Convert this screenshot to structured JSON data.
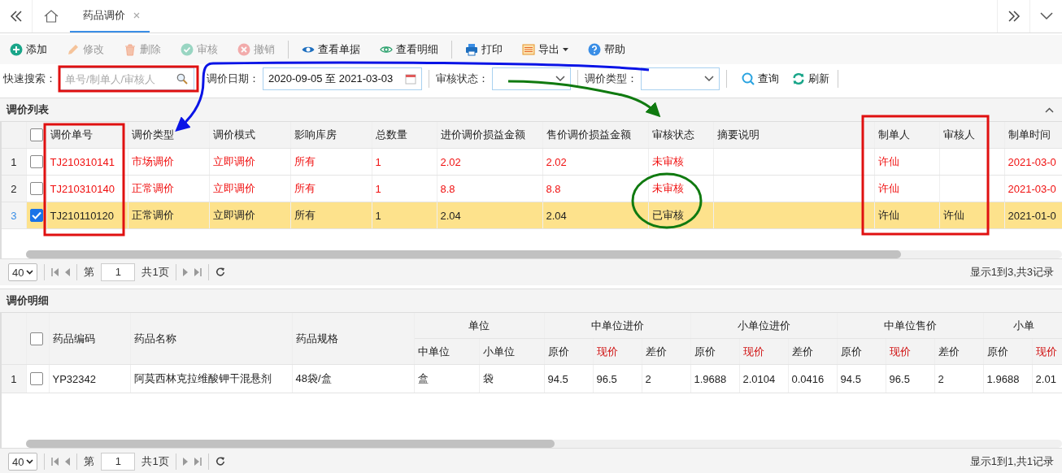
{
  "tab_bar": {
    "tabs": [
      {
        "label": "药品调价",
        "selected": true,
        "closable": true
      }
    ]
  },
  "toolbar_groups": [
    {
      "buttons": [
        {
          "kind": "add",
          "label": "添加",
          "disabled": false
        },
        {
          "kind": "edit",
          "label": "修改",
          "disabled": true
        },
        {
          "kind": "delete",
          "label": "删除",
          "disabled": true
        },
        {
          "kind": "audit",
          "label": "审核",
          "disabled": true
        },
        {
          "kind": "revoke",
          "label": "撤销",
          "disabled": true
        }
      ]
    },
    {
      "buttons": [
        {
          "kind": "view",
          "label": "查看单据",
          "disabled": false
        },
        {
          "kind": "detail",
          "label": "查看明细",
          "disabled": false
        }
      ]
    },
    {
      "buttons": [
        {
          "kind": "print",
          "label": "打印",
          "disabled": false
        },
        {
          "kind": "export",
          "label": "导出",
          "disabled": false,
          "dropdown": true
        },
        {
          "kind": "help",
          "label": "帮助",
          "disabled": false
        }
      ]
    }
  ],
  "filters": {
    "quick_search": {
      "label": "快速搜索：",
      "placeholder": "单号/制单人/审核人"
    },
    "date": {
      "label": "调价日期：",
      "value": "2020-09-05 至 2021-03-03"
    },
    "status": {
      "label": "审核状态："
    },
    "type": {
      "label": "调价类型："
    },
    "actions": [
      {
        "kind": "search",
        "label": "查询"
      },
      {
        "kind": "refresh",
        "label": "刷新"
      }
    ]
  },
  "list_panel": {
    "title": "调价列表",
    "all_checked": false,
    "columns": [
      "调价单号",
      "调价类型",
      "调价模式",
      "影响库房",
      "总数量",
      "进价调价损益金额",
      "售价调价损益金额",
      "审核状态",
      "摘要说明",
      "制单人",
      "审核人",
      "制单时间"
    ],
    "rows": [
      {
        "row_number": "1",
        "selected": false,
        "pending": true,
        "cells": [
          "TJ210310141",
          "市场调价",
          "立即调价",
          "所有",
          "1",
          "2.02",
          "2.02",
          "未审核",
          null,
          "许仙",
          null,
          "2021-03-0"
        ]
      },
      {
        "row_number": "2",
        "selected": false,
        "pending": true,
        "cells": [
          "TJ210310140",
          "正常调价",
          "立即调价",
          "所有",
          "1",
          "8.8",
          "8.8",
          "未审核",
          null,
          "许仙",
          null,
          "2021-03-0"
        ]
      },
      {
        "row_number": "3",
        "selected": true,
        "pending": false,
        "cells": [
          "TJ210110120",
          "正常调价",
          "立即调价",
          "所有",
          "1",
          "2.04",
          "2.04",
          "已审核",
          null,
          "许仙",
          "许仙",
          "2021-01-0"
        ]
      }
    ],
    "pager": {
      "page_size": "40",
      "page_label": "第",
      "page": "1",
      "total_pages": "共1页",
      "summary": "显示1到3,共3记录"
    }
  },
  "detail_panel": {
    "title": "调价明细",
    "all_checked": false,
    "fixed_columns": [
      "药品编码",
      "药品名称",
      "药品规格"
    ],
    "groups": [
      {
        "label": "单位",
        "columns": [
          {
            "label": "中单位",
            "emphasis": false
          },
          {
            "label": "小单位",
            "emphasis": false
          }
        ]
      },
      {
        "label": "中单位进价",
        "columns": [
          {
            "label": "原价",
            "emphasis": false
          },
          {
            "label": "现价",
            "emphasis": true
          },
          {
            "label": "差价",
            "emphasis": false
          }
        ]
      },
      {
        "label": "小单位进价",
        "columns": [
          {
            "label": "原价",
            "emphasis": false
          },
          {
            "label": "现价",
            "emphasis": true
          },
          {
            "label": "差价",
            "emphasis": false
          }
        ]
      },
      {
        "label": "中单位售价",
        "columns": [
          {
            "label": "原价",
            "emphasis": false
          },
          {
            "label": "现价",
            "emphasis": true
          },
          {
            "label": "差价",
            "emphasis": false
          }
        ]
      },
      {
        "label": "小单",
        "columns": [
          {
            "label": "原价",
            "emphasis": false
          },
          {
            "label": "现价",
            "emphasis": true
          }
        ]
      }
    ],
    "rows": [
      {
        "row_number": "1",
        "selected": false,
        "cells": [
          "YP32342",
          "阿莫西林克拉维酸钾干混悬剂",
          "48袋/盒",
          "盒",
          "袋",
          "94.5",
          "96.5",
          "2",
          "1.9688",
          "2.0104",
          "0.0416",
          "94.5",
          "96.5",
          "2",
          "1.9688",
          "2.01"
        ]
      }
    ],
    "pager": {
      "page_size": "40",
      "page_label": "第",
      "page": "1",
      "total_pages": "共1页",
      "summary": "显示1到1,共1记录"
    }
  }
}
